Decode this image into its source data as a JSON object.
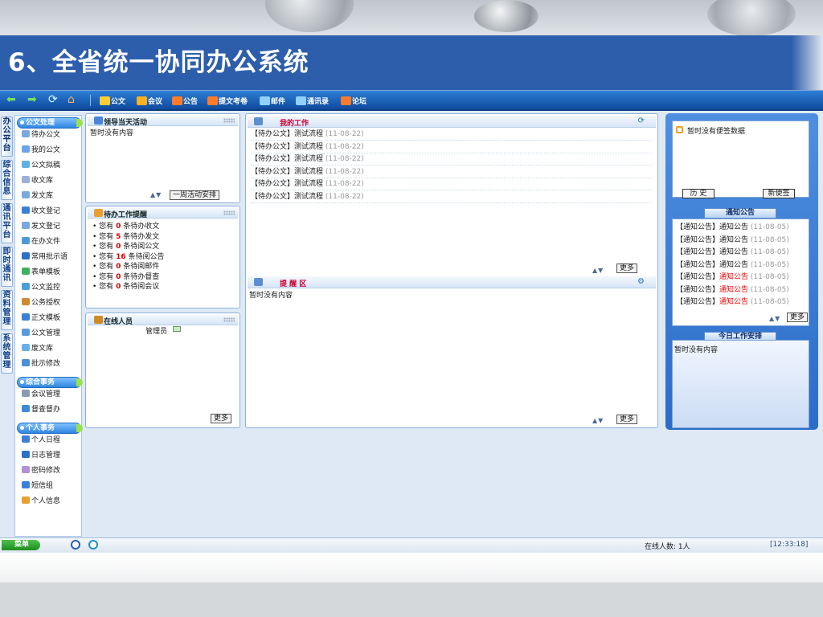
{
  "slide": {
    "title": "6、全省统一协同办公系统"
  },
  "toolbar": {
    "items": [
      {
        "label": "公文",
        "icon": "document-icon",
        "color": "#ffcc33"
      },
      {
        "label": "会议",
        "icon": "meeting-icon",
        "color": "#ffb020"
      },
      {
        "label": "公告",
        "icon": "notice-icon",
        "color": "#ff7a2a"
      },
      {
        "label": "提文考卷",
        "icon": "exam-icon",
        "color": "#ff7a2a"
      },
      {
        "label": "邮件",
        "icon": "mail-icon",
        "color": "#8fd0ff"
      },
      {
        "label": "通讯录",
        "icon": "address-book-icon",
        "color": "#8fd0ff"
      },
      {
        "label": "论坛",
        "icon": "forum-icon",
        "color": "#ff7a2a"
      }
    ]
  },
  "vtabs": [
    {
      "label": "办公平台"
    },
    {
      "label": "综合信息"
    },
    {
      "label": "通讯平台"
    },
    {
      "label": "即时通讯"
    },
    {
      "label": "资料管理"
    },
    {
      "label": "系统管理"
    }
  ],
  "menu": {
    "group1": "公文处理",
    "group1_items": [
      {
        "label": "待办公文"
      },
      {
        "label": "我的公文"
      },
      {
        "label": "公文拟稿"
      },
      {
        "label": "收文库"
      },
      {
        "label": "发文库"
      },
      {
        "label": "收文登记"
      },
      {
        "label": "发文登记"
      },
      {
        "label": "在办文件"
      },
      {
        "label": "常用批示语"
      },
      {
        "label": "表单模板"
      },
      {
        "label": "公文监控"
      },
      {
        "label": "公务授权"
      },
      {
        "label": "正文模板"
      },
      {
        "label": "公文管理"
      },
      {
        "label": "废文库"
      },
      {
        "label": "批示修改"
      }
    ],
    "group2": "综合事务",
    "group2_items": [
      {
        "label": "会议管理"
      },
      {
        "label": "督查督办"
      }
    ],
    "group3": "个人事务",
    "group3_items": [
      {
        "label": "个人日程"
      },
      {
        "label": "日志管理"
      },
      {
        "label": "密码修改"
      },
      {
        "label": "短信组"
      },
      {
        "label": "个人信息"
      }
    ]
  },
  "leader": {
    "title": "领导当天活动",
    "empty": "暂时没有内容",
    "week_btn": "一周活动安排"
  },
  "todo": {
    "title": "待办工作提醒",
    "rows": [
      {
        "pre": "您有",
        "n": "0",
        "post": "条待办收文"
      },
      {
        "pre": "您有",
        "n": "5",
        "post": "条待办发文"
      },
      {
        "pre": "您有",
        "n": "0",
        "post": "条待阅公文"
      },
      {
        "pre": "您有",
        "n": "16",
        "post": "条待阅公告"
      },
      {
        "pre": "您有",
        "n": "0",
        "post": "条待阅邮件"
      },
      {
        "pre": "您有",
        "n": "0",
        "post": "条待办督查"
      },
      {
        "pre": "您有",
        "n": "0",
        "post": "条待阅会议"
      }
    ]
  },
  "online": {
    "title": "在线人员",
    "user": "管理员",
    "more": "更多"
  },
  "mywork": {
    "title": "我的工作",
    "rows": [
      {
        "tag": "【待办公文】",
        "name": "测试流程",
        "date": "(11-08-22)"
      },
      {
        "tag": "【待办公文】",
        "name": "测试流程",
        "date": "(11-08-22)"
      },
      {
        "tag": "【待办公文】",
        "name": "测试流程",
        "date": "(11-08-22)"
      },
      {
        "tag": "【待办公文】",
        "name": "测试流程",
        "date": "(11-08-22)"
      },
      {
        "tag": "【待办公文】",
        "name": "测试流程",
        "date": "(11-08-22)"
      },
      {
        "tag": "【待办公文】",
        "name": "测试流程",
        "date": "(11-08-22)"
      }
    ],
    "more": "更多"
  },
  "remind": {
    "title": "提 醒 区",
    "empty": "暂时没有内容",
    "more": "更多"
  },
  "notes": {
    "empty": "暂时没有便签数据",
    "history": "历 史",
    "new": "新便签"
  },
  "notice": {
    "title": "通知公告",
    "rows": [
      {
        "tag": "【通知公告】",
        "name": "通知公告",
        "date": "(11-08-05)",
        "red": false
      },
      {
        "tag": "【通知公告】",
        "name": "通知公告",
        "date": "(11-08-05)",
        "red": false
      },
      {
        "tag": "【通知公告】",
        "name": "通知公告",
        "date": "(11-08-05)",
        "red": false
      },
      {
        "tag": "【通知公告】",
        "name": "通知公告",
        "date": "(11-08-05)",
        "red": false
      },
      {
        "tag": "【通知公告】",
        "name": "通知公告",
        "date": "(11-08-05)",
        "red": true
      },
      {
        "tag": "【通知公告】",
        "name": "通知公告",
        "date": "(11-08-05)",
        "red": true
      },
      {
        "tag": "【通知公告】",
        "name": "通知公告",
        "date": "(11-08-05)",
        "red": true
      },
      {
        "tag": "【通知公告】",
        "name": "通知公告",
        "date": "(11-08-05)",
        "red": true
      }
    ],
    "more": "更多"
  },
  "today": {
    "title": "今日工作安排",
    "empty": "暂时没有内容"
  },
  "status": {
    "menu": "菜单",
    "online": "在线人数: 1人",
    "time": "[12:33:18]"
  }
}
